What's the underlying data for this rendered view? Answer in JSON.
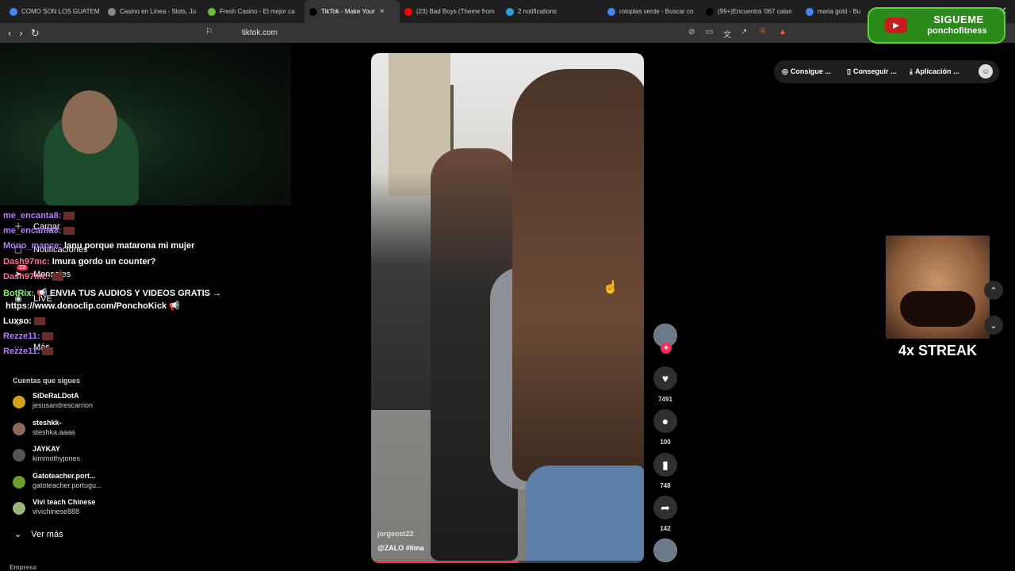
{
  "browser": {
    "tabs": [
      {
        "label": "COMO SON LOS GUATEM",
        "icon": "chrome-icon",
        "color": "#4285f4"
      },
      {
        "label": "Casino en Línea - Slots, Ju",
        "icon": "s-icon",
        "color": "#888888"
      },
      {
        "label": "Fresh Casino - El mejor ca",
        "icon": "fresh-icon",
        "color": "#6bbf2a"
      },
      {
        "label": "TikTok - Make Your",
        "icon": "tiktok-icon",
        "color": "#000000"
      },
      {
        "label": "(23) Bad Boys (Theme from",
        "icon": "youtube-icon",
        "color": "#ff0000"
      },
      {
        "label": "2 notifications",
        "icon": "telegram-icon",
        "color": "#2aa1da"
      },
      {
        "label": "rotoplas verde - Buscar co",
        "icon": "chrome-icon",
        "color": "#4285f4"
      },
      {
        "label": "(99+)Encuentra '067 calan",
        "icon": "tiktok-icon",
        "color": "#000000"
      },
      {
        "label": "maria gold - Bu",
        "icon": "chrome-icon",
        "color": "#4285f4"
      }
    ],
    "url": "tiktok.com",
    "extension_badge": "1"
  },
  "overlay": {
    "sigueme": "SIGUEME",
    "handle": "ponchofitness",
    "streak": "4x STREAK"
  },
  "chat": [
    {
      "user": "me_encanta8:",
      "text": "",
      "emote": true,
      "color": "#b47cff"
    },
    {
      "user": "me_encanta8:",
      "text": "",
      "emote": true,
      "color": "#b47cff"
    },
    {
      "user": "Mono_mance:",
      "text": "lanu porque matarona mi mujer",
      "emote": false,
      "color": "#b47cff"
    },
    {
      "user": "Dash97mc:",
      "text": "Imura gordo un counter?",
      "emote": false,
      "color": "#ff6fa0"
    },
    {
      "user": "Dash97mc:",
      "text": "",
      "emote": true,
      "color": "#ff6fa0"
    },
    {
      "user": "BotRix:",
      "text": "📢 ENVIA TUS AUDIOS Y VIDEOS GRATIS →",
      "emote": false,
      "color": "#7dff5a"
    },
    {
      "user": "",
      "text": "https://www.donoclip.com/PonchoKick 📢",
      "emote": false,
      "color": "#ffffff"
    },
    {
      "user": "Luxso:",
      "text": "",
      "emote": true,
      "color": "#ffffff"
    },
    {
      "user": "Rezze11:",
      "text": "",
      "emote": true,
      "color": "#b47cff"
    },
    {
      "user": "Rezze11:",
      "text": "",
      "emote": true,
      "color": "#b47cff"
    }
  ],
  "sidebar": {
    "cargar": "Cargar",
    "notificaciones": "Notificaciones",
    "mensajes": "Mensajes",
    "mensajes_badge": "23",
    "live": "LIVE",
    "mas": "Más",
    "following_title": "Cuentas que sigues",
    "following": [
      {
        "name": "SiDeRaLDotA",
        "user": "jesusandrescarrion",
        "color": "#d4a017"
      },
      {
        "name": "steshkk-",
        "user": "steshka.aaaa",
        "color": "#8a6a5a"
      },
      {
        "name": "JAYKAY",
        "user": "kimmothyjones",
        "color": "#555555"
      },
      {
        "name": "Gatoteacher.port...",
        "user": "gatoteacher.portugu...",
        "color": "#6b9e2a"
      },
      {
        "name": "Vivi teach Chinese",
        "user": "vivichinese888",
        "color": "#9ab87a"
      }
    ],
    "ver_mas": "Ver más",
    "empresa": "Empresa"
  },
  "top_actions": [
    {
      "label": "Consigue ...",
      "icon": "coin-icon"
    },
    {
      "label": "Conseguir ...",
      "icon": "phone-icon"
    },
    {
      "label": "Aplicación ...",
      "icon": "download-icon"
    }
  ],
  "video": {
    "author": "jorgeost22",
    "caption": "@ZALO  #lima",
    "progress": 0.54,
    "likes": "7491",
    "comments": "100",
    "saves": "748",
    "shares": "142"
  }
}
